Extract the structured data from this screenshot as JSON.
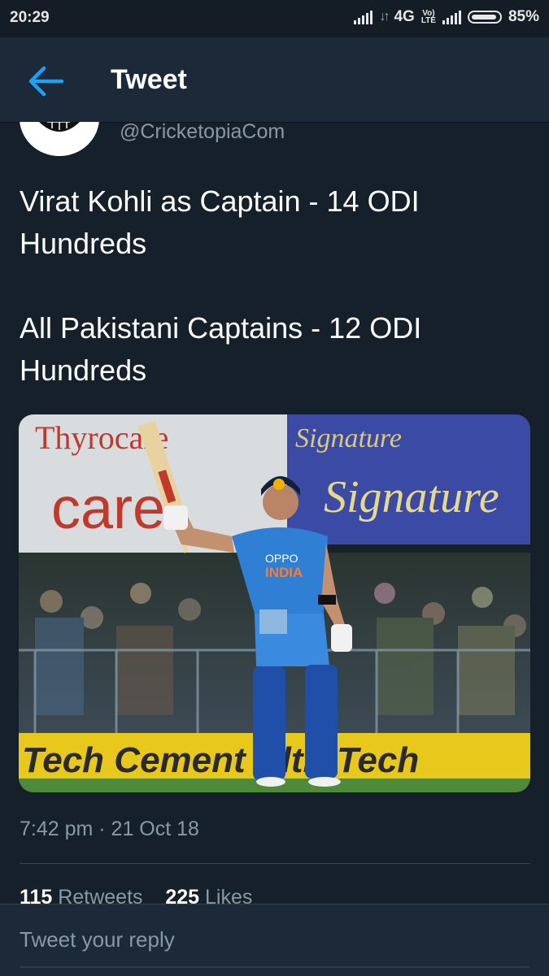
{
  "status_bar": {
    "time": "20:29",
    "network": "4G",
    "volte": "Vo LTE",
    "battery": "85%",
    "battery_level": 0.85
  },
  "header": {
    "back_icon": "back-arrow-icon",
    "title": "Tweet"
  },
  "tweet": {
    "handle": "@CricketopiaCom",
    "lines": [
      "Virat Kohli as Captain - 14 ODI Hundreds",
      "All Pakistani Captains - 12 ODI Hundreds"
    ],
    "media_signage": {
      "sponsor_left": "Thyrocare",
      "sponsor_left_big": "care",
      "sponsor_right": "Signature",
      "jersey_brand": "OPPO",
      "jersey_team": "INDIA",
      "board": "Tech Cement UltraTech"
    },
    "timestamp": "7:42 pm · 21 Oct 18",
    "stats": {
      "retweets_count": "115",
      "retweets_label": "Retweets",
      "likes_count": "225",
      "likes_label": "Likes"
    }
  },
  "reply": {
    "placeholder": "Tweet your reply"
  },
  "colors": {
    "background": "#15202b",
    "header": "#1c2938",
    "accent": "#1da1f2",
    "muted": "#8899a6"
  }
}
